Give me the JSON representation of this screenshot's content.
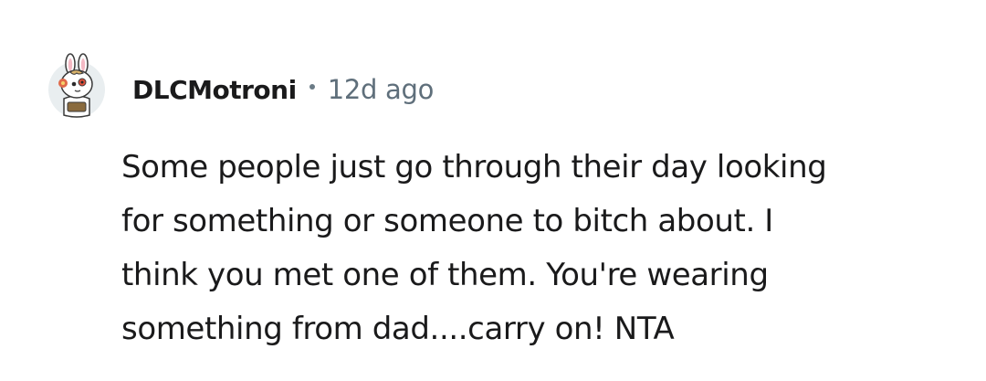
{
  "comment": {
    "author": "DLCMotroni",
    "separator": "•",
    "time_ago": "12d ago",
    "body_lines": [
      "Some people just go through their day looking",
      "for something or someone to bitch about. I",
      "think you met one of them. You're wearing",
      "something from dad....carry on! NTA"
    ],
    "avatar_icon": "snoo-bunny-avatar-icon"
  }
}
